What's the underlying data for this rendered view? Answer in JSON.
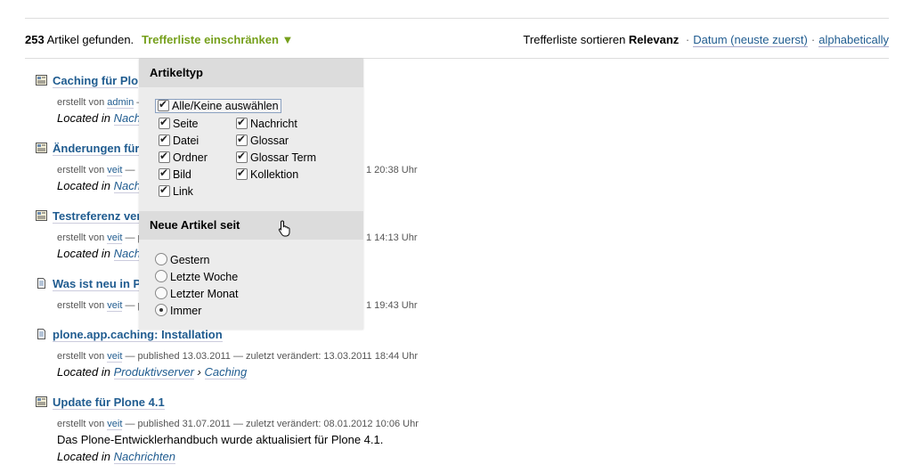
{
  "header": {
    "count_number": "253",
    "count_text": "Artikel gefunden.",
    "filter_toggle": "Trefferliste einschränken",
    "filter_arrow": "▼",
    "sort_label": "Trefferliste sortieren",
    "sort_active": "Relevanz",
    "sort_date": "Datum (neuste zuerst)",
    "sort_alpha": "alphabetically",
    "sep": "·"
  },
  "results": [
    {
      "title": "Caching für Plo",
      "meta_prefix": "erstellt von",
      "author": "admin",
      "meta_rest": " —",
      "location_prefix": "Located in",
      "location": "Nach"
    },
    {
      "title": "Änderungen für",
      "meta_prefix": "erstellt von",
      "author": "veit",
      "meta_rest": " —",
      "meta_tail": "1 20:38 Uhr",
      "location_prefix": "Located in",
      "location": "Nach"
    },
    {
      "title": "Testreferenz ver",
      "meta_prefix": "erstellt von",
      "author": "veit",
      "meta_rest": " — p",
      "meta_tail": "1 14:13 Uhr",
      "location_prefix": "Located in",
      "location": "Nach"
    },
    {
      "title": "Was ist neu in P",
      "meta_prefix": "erstellt von",
      "author": "veit",
      "meta_rest": " — p",
      "meta_tail": "1 19:43 Uhr"
    },
    {
      "title": "plone.app.caching: Installation",
      "meta_prefix": "erstellt von",
      "author": "veit",
      "meta_rest": " — published 13.03.2011 — zuletzt verändert: 13.03.2011 18:44 Uhr",
      "location_prefix": "Located in",
      "location": "Produktivserver",
      "location_sep": " › ",
      "location2": "Caching"
    },
    {
      "title": "Update für Plone 4.1",
      "meta_prefix": "erstellt von",
      "author": "veit",
      "meta_rest": " — published 31.07.2011 — zuletzt verändert: 08.01.2012 10:06 Uhr",
      "description": "Das Plone-Entwicklerhandbuch wurde aktualisiert für Plone 4.1.",
      "location_prefix": "Located in",
      "location": "Nachrichten"
    }
  ],
  "filter": {
    "section1_title": "Artikeltyp",
    "select_all": "Alle/Keine auswählen",
    "types_left": [
      "Seite",
      "Datei",
      "Ordner",
      "Bild",
      "Link"
    ],
    "types_right": [
      "Nachricht",
      "Glossar",
      "Glossar Term",
      "Kollektion"
    ],
    "section2_title": "Neue Artikel seit",
    "since_options": [
      "Gestern",
      "Letzte Woche",
      "Letzter Monat",
      "Immer"
    ],
    "since_selected": "Immer"
  }
}
